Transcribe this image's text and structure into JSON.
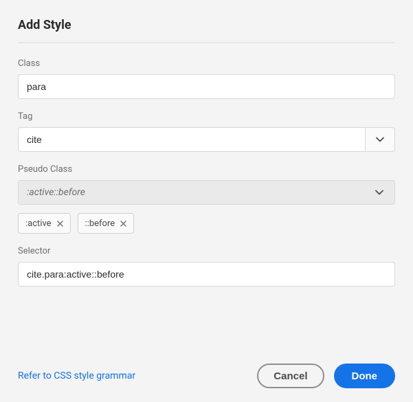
{
  "title": "Add Style",
  "fields": {
    "class": {
      "label": "Class",
      "value": "para"
    },
    "tag": {
      "label": "Tag",
      "value": "cite"
    },
    "pseudo": {
      "label": "Pseudo Class",
      "value": ":active::before"
    },
    "selector": {
      "label": "Selector",
      "value": "cite.para:active::before"
    }
  },
  "tags": [
    {
      "label": ":active"
    },
    {
      "label": "::before"
    }
  ],
  "footer": {
    "link": "Refer to CSS style grammar",
    "cancel": "Cancel",
    "done": "Done"
  }
}
